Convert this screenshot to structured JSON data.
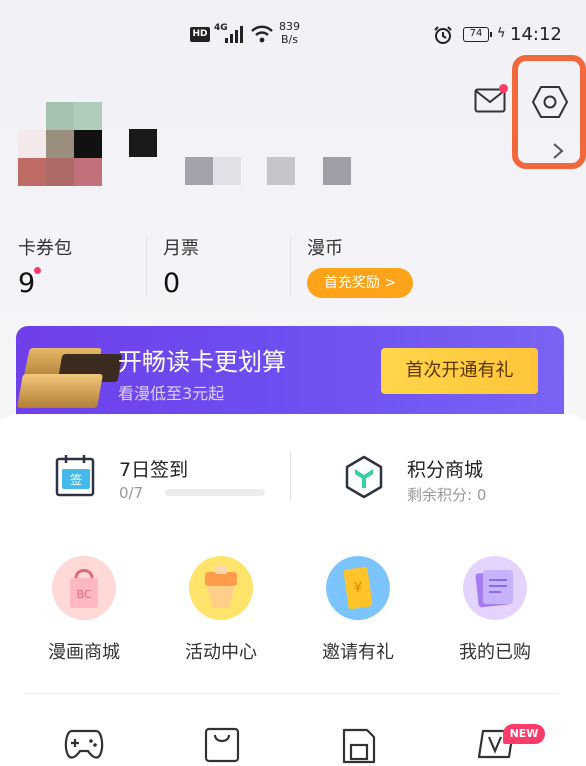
{
  "status_bar": {
    "hd": "HD",
    "network": "4G",
    "speed_value": "839",
    "speed_unit": "B/s",
    "battery": "74",
    "time": "14:12"
  },
  "header": {
    "mail_icon": "envelope-icon",
    "settings_icon": "hexagon-settings-icon",
    "highlight_color": "#f0683c"
  },
  "stats": {
    "coupons": {
      "label": "卡券包",
      "value": "9"
    },
    "monthly_tickets": {
      "label": "月票",
      "value": "0"
    },
    "coins": {
      "label": "漫币",
      "button": "首充奖励 >"
    }
  },
  "banner": {
    "title": "开畅读卡更划算",
    "subtitle": "看漫低至3元起",
    "button": "首次开通有礼"
  },
  "checkin": {
    "title": "7日签到",
    "progress_text": "0/7",
    "progress": 0
  },
  "points_shop": {
    "title": "积分商城",
    "points_text": "剩余积分: 0"
  },
  "grid": [
    {
      "label": "漫画商城",
      "icon": "shopping-bag-icon"
    },
    {
      "label": "活动中心",
      "icon": "activity-center-icon"
    },
    {
      "label": "邀请有礼",
      "icon": "red-envelope-icon"
    },
    {
      "label": "我的已购",
      "icon": "purchased-books-icon"
    }
  ],
  "bottom_row": {
    "new_badge": "NEW"
  },
  "colors": {
    "accent_orange": "#ffa31a",
    "badge_red": "#ff3b6b",
    "banner_purple": "#6f3fe9",
    "banner_button_yellow": "#ffd64a"
  }
}
